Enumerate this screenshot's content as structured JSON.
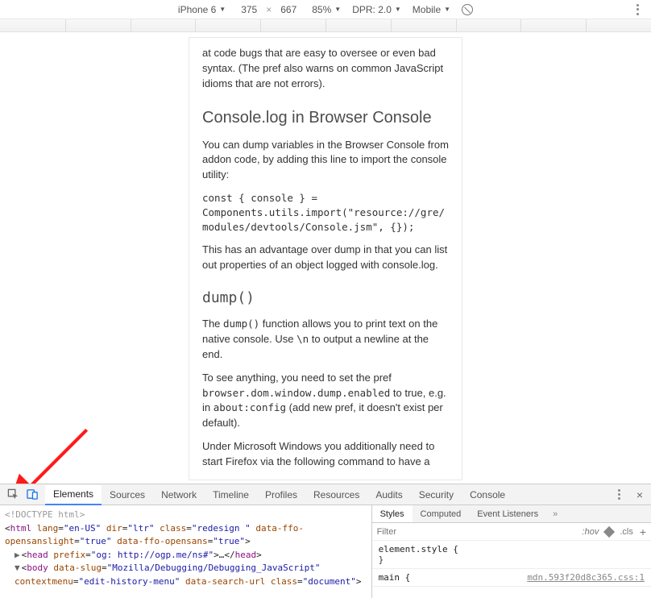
{
  "device_bar": {
    "device": "iPhone 6",
    "width": "375",
    "height": "667",
    "zoom": "85%",
    "dpr_label": "DPR: 2.0",
    "mode": "Mobile"
  },
  "page": {
    "intro_fragment": "at code bugs that are easy to oversee or even bad syntax. (The pref also warns on common JavaScript idioms that are not errors).",
    "h_console": "Console.log in Browser Console",
    "p_console1": "You can dump variables in the Browser Console from addon code, by adding this line to import the console utility:",
    "code_import": "const { console } =\nComponents.utils.import(\"resource://gre/modules/devtools/Console.jsm\", {});",
    "p_console2": "This has an advantage over dump in that you can list out properties of an object logged with console.log.",
    "h_dump": "dump()",
    "p_dump1_a": "The ",
    "p_dump1_code": "dump()",
    "p_dump1_b": " function allows you to print text on the native console. Use ",
    "p_dump1_code2": "\\n",
    "p_dump1_c": " to output a newline at the end.",
    "p_dump2_a": "To see anything, you need to set the pref ",
    "p_dump2_code": "browser.dom.window.dump.enabled",
    "p_dump2_b": " to true, e.g. in ",
    "p_dump2_code2": "about:config",
    "p_dump2_c": " (add new pref, it doesn't exist per default).",
    "p_dump3": "Under Microsoft Windows you additionally need to start Firefox via the following command to have a"
  },
  "devtools": {
    "tabs": [
      "Elements",
      "Sources",
      "Network",
      "Timeline",
      "Profiles",
      "Resources",
      "Audits",
      "Security",
      "Console"
    ],
    "active_tab": "Elements",
    "dom": {
      "doctype": "<!DOCTYPE html>",
      "html_open": "<html lang=\"en-US\" dir=\"ltr\" class=\"redesign \" data-ffo-opensanslight=\"true\" data-ffo-opensans=\"true\">",
      "head": "<head prefix=\"og: http://ogp.me/ns#\">…</head>",
      "body_open": "<body data-slug=\"Mozilla/Debugging/Debugging_JavaScript\" contextmenu=\"edit-history-menu\" data-search-url class=\"document\">"
    },
    "styles": {
      "tabs": [
        "Styles",
        "Computed",
        "Event Listeners"
      ],
      "filter_placeholder": "Filter",
      "hov": ":hov",
      "cls": ".cls",
      "rule1_sel": "element.style {",
      "rule1_close": "}",
      "rule2_sel": "main {",
      "rule2_src": "mdn.593f20d8c365.css:1"
    }
  }
}
